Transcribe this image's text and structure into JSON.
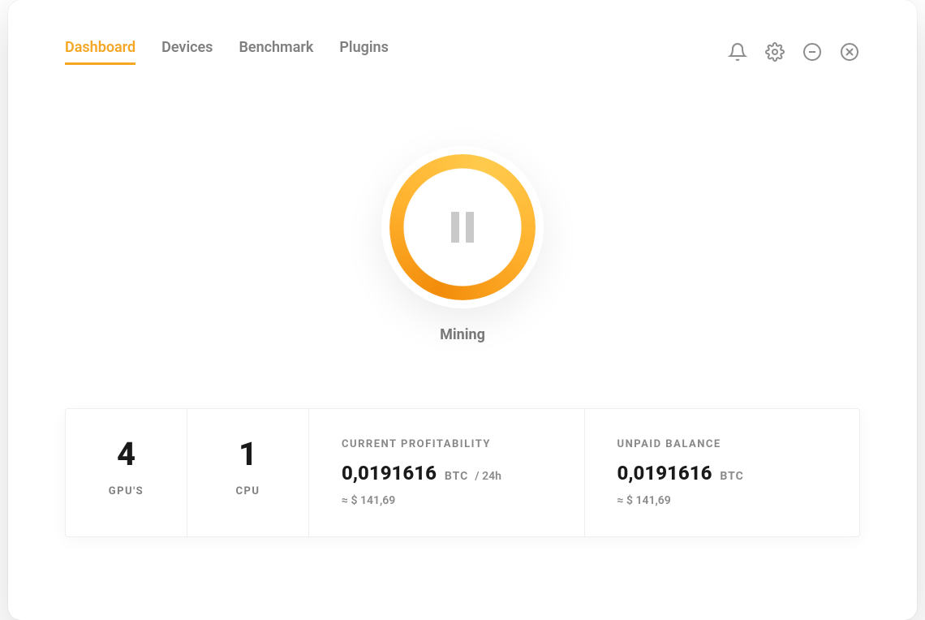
{
  "tabs": {
    "dashboard": "Dashboard",
    "devices": "Devices",
    "benchmark": "Benchmark",
    "plugins": "Plugins"
  },
  "mining": {
    "label": "Mining"
  },
  "stats": {
    "gpu": {
      "value": "4",
      "label": "GPU'S"
    },
    "cpu": {
      "value": "1",
      "label": "CPU"
    },
    "profitability": {
      "title": "CURRENT PROFITABILITY",
      "amount": "0,0191616",
      "unit": "BTC",
      "per": "/ 24h",
      "approx": "≈ $ 141,69"
    },
    "balance": {
      "title": "UNPAID BALANCE",
      "amount": "0,0191616",
      "unit": "BTC",
      "approx": "≈ $ 141,69"
    }
  },
  "colors": {
    "accent": "#f5a623"
  }
}
